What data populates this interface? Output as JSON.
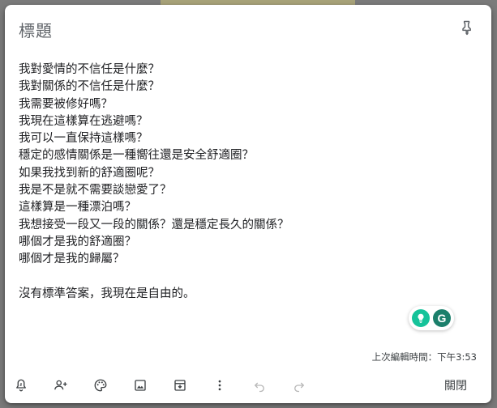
{
  "note": {
    "title_placeholder": "標題",
    "lines": [
      "我對愛情的不信任是什麼？",
      "我對關係的不信任是什麼？",
      "我需要被修好嗎？",
      "我現在這樣算在逃避嗎？",
      "我可以一直保持這樣嗎？",
      "穩定的感情關係是一種嚮往還是安全舒適圈？",
      "如果我找到新的舒適圈呢？",
      "我是不是就不需要談戀愛了？",
      "這樣算是一種漂泊嗎？",
      "我想接受一段又一段的關係？還是穩定長久的關係？",
      "哪個才是我的舒適圈？",
      "哪個才是我的歸屬？",
      "",
      "沒有標準答案，我現在是自由的。"
    ],
    "edited_label": "上次編輯時間：下午3:53",
    "close_label": "關閉"
  },
  "extension": {
    "badge_letter": "G"
  },
  "toolbar": {
    "icons": [
      "reminder-bell-icon",
      "collaborator-icon",
      "palette-icon",
      "image-icon",
      "archive-icon",
      "more-vert-icon",
      "undo-icon",
      "redo-icon"
    ]
  },
  "colors": {
    "accent_teal": "#15c39a",
    "grammarly_green": "#1b7f6b",
    "text_primary": "#202124",
    "text_secondary": "#5f6368"
  }
}
